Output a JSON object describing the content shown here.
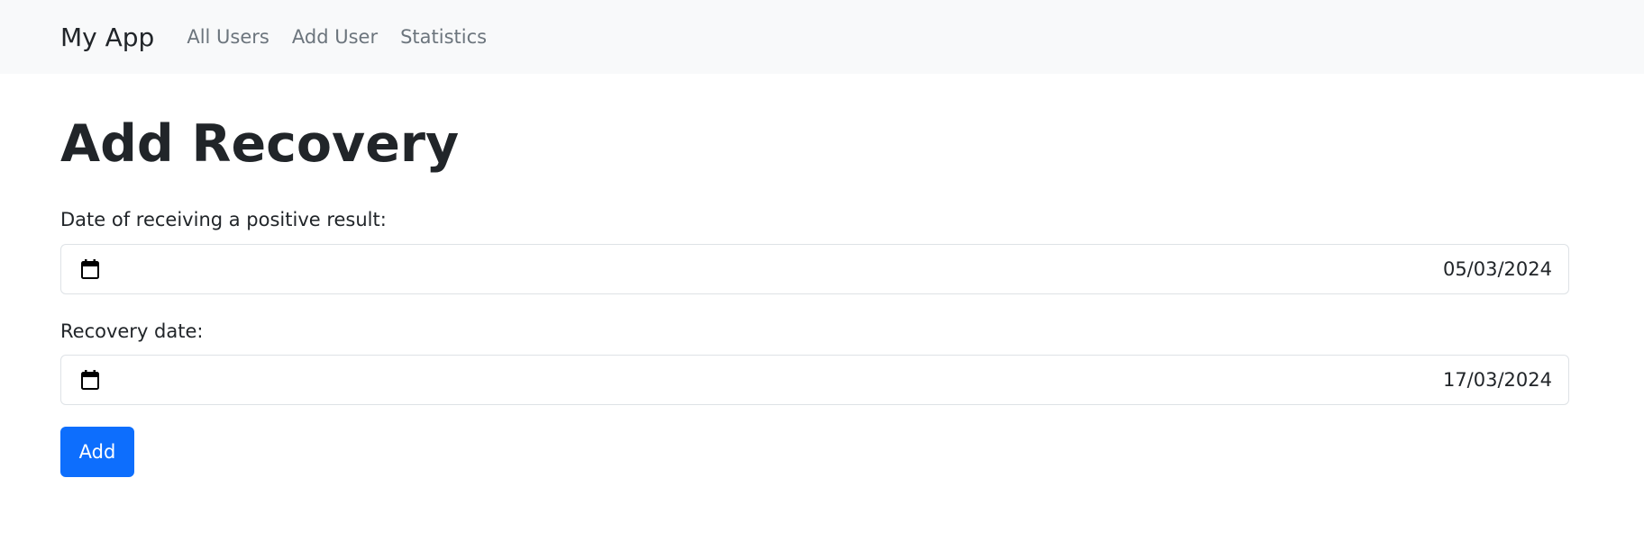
{
  "navbar": {
    "brand": "My App",
    "links": [
      "All Users",
      "Add User",
      "Statistics"
    ]
  },
  "page": {
    "title": "Add Recovery"
  },
  "form": {
    "positive_date": {
      "label": "Date of receiving a positive result:",
      "value": "05/03/2024",
      "icon": "calendar-icon"
    },
    "recovery_date": {
      "label": "Recovery date:",
      "value": "17/03/2024",
      "icon": "calendar-icon"
    },
    "submit_label": "Add"
  },
  "colors": {
    "navbar_bg": "#f8f9fa",
    "primary": "#0d6efd",
    "nav_link": "#6c757d",
    "text": "#212529"
  }
}
